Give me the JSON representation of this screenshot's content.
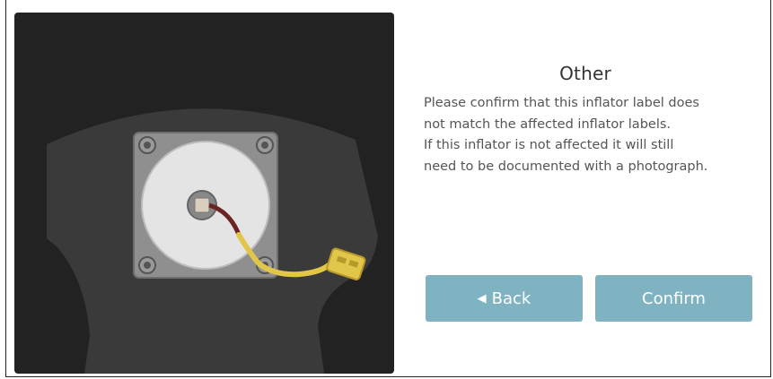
{
  "dialog": {
    "title": "Other",
    "message_lines": [
      "Please confirm that this inflator label does",
      "not match the affected inflator labels.",
      "If this inflator is not affected it will still",
      "need to be documented with a photograph."
    ]
  },
  "buttons": {
    "back_label": "Back",
    "back_icon": "left-triangle-icon",
    "confirm_label": "Confirm"
  },
  "colors": {
    "button_bg": "#7fb3c2",
    "illustration_bg": "#222222",
    "airbag_body": "#3a3a3a",
    "connector": "#e2c64a"
  }
}
